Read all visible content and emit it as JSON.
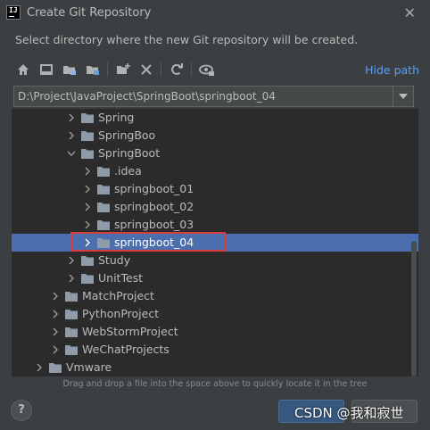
{
  "window": {
    "title": "Create Git Repository",
    "subtitle": "Select directory where the new Git repository will be created."
  },
  "toolbar": {
    "buttons": [
      "home-icon",
      "desktop-icon",
      "project-folder-icon",
      "module-folder-icon",
      "new-folder-icon",
      "delete-icon",
      "refresh-icon",
      "show-hidden-icon"
    ],
    "hide_path_label": "Hide path"
  },
  "path": {
    "value": "D:\\Project\\JavaProject\\SpringBoot\\springboot_04"
  },
  "tree": {
    "rows": [
      {
        "label": "Spring",
        "indent": 3,
        "expanded": false,
        "selected": false
      },
      {
        "label": "SpringBoo",
        "indent": 3,
        "expanded": false,
        "selected": false
      },
      {
        "label": "SpringBoot",
        "indent": 3,
        "expanded": true,
        "selected": false
      },
      {
        "label": ".idea",
        "indent": 4,
        "expanded": false,
        "selected": false
      },
      {
        "label": "springboot_01",
        "indent": 4,
        "expanded": false,
        "selected": false
      },
      {
        "label": "springboot_02",
        "indent": 4,
        "expanded": false,
        "selected": false
      },
      {
        "label": "springboot_03",
        "indent": 4,
        "expanded": false,
        "selected": false
      },
      {
        "label": "springboot_04",
        "indent": 4,
        "expanded": false,
        "selected": true
      },
      {
        "label": "Study",
        "indent": 3,
        "expanded": false,
        "selected": false
      },
      {
        "label": "UnitTest",
        "indent": 3,
        "expanded": false,
        "selected": false
      },
      {
        "label": "MatchProject",
        "indent": 2,
        "expanded": false,
        "selected": false
      },
      {
        "label": "PythonProject",
        "indent": 2,
        "expanded": false,
        "selected": false
      },
      {
        "label": "WebStormProject",
        "indent": 2,
        "expanded": false,
        "selected": false
      },
      {
        "label": "WeChatProjects",
        "indent": 2,
        "expanded": false,
        "selected": false
      },
      {
        "label": "Vmware",
        "indent": 1,
        "expanded": false,
        "selected": false
      }
    ]
  },
  "hint": "Drag and drop a file into the space above to quickly locate it in the tree",
  "footer": {
    "help_label": "?",
    "ok_label": "",
    "cancel_label": ""
  },
  "watermark": "CSDN @我和寂世",
  "colors": {
    "background": "#3c3f41",
    "tree_background": "#2b2b2b",
    "selection": "#4b6eaf",
    "link": "#589df6",
    "annotation_border": "#d93c3c",
    "folder": "#8f9ba8"
  }
}
